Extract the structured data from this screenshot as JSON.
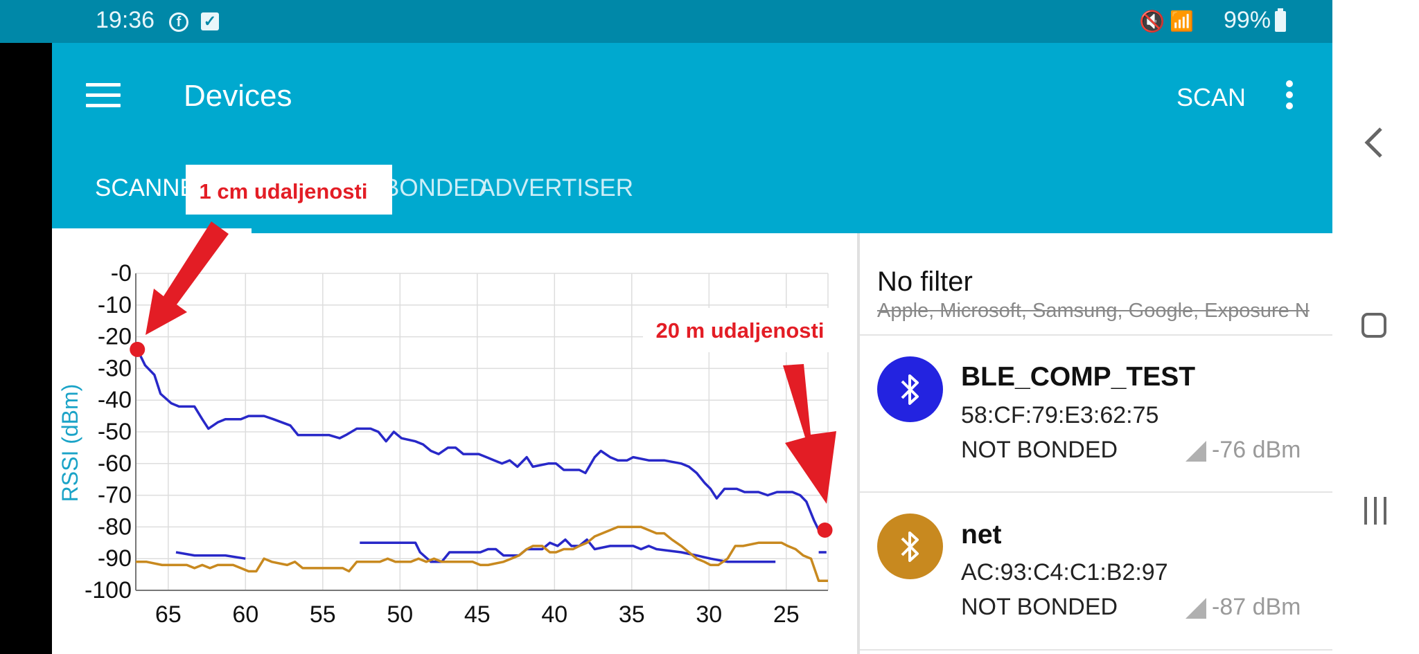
{
  "status_bar": {
    "time": "19:36",
    "battery": "99%"
  },
  "toolbar": {
    "title": "Devices",
    "scan_label": "SCAN"
  },
  "tabs": {
    "scanner": "SCANNER",
    "bonded": "BONDED",
    "advertiser": "ADVERTISER"
  },
  "annotations": {
    "near": "1 cm udaljenosti",
    "far": "20 m udaljenosti"
  },
  "filter": {
    "title": "No filter",
    "subtitle": "Apple, Microsoft, Samsung, Google, Exposure N"
  },
  "devices": [
    {
      "name": "BLE_COMP_TEST",
      "mac": "58:CF:79:E3:62:75",
      "bond": "NOT BONDED",
      "rssi": "-76 dBm",
      "color": "#2323e0"
    },
    {
      "name": "net",
      "mac": "AC:93:C4:C1:B2:97",
      "bond": "NOT BONDED",
      "rssi": "-87 dBm",
      "color": "#c8891f"
    }
  ],
  "colors": {
    "status_bar": "#0088a8",
    "app_bar": "#00a9cf",
    "annotation": "#e31d25",
    "axis_label": "#1aa3c7"
  },
  "chart_data": {
    "type": "line",
    "ylabel": "RSSI (dBm)",
    "xlabel": "",
    "xlim": [
      67.1,
      22.3
    ],
    "ylim": [
      -100,
      0
    ],
    "y_ticks": [
      "-0",
      "-10",
      "-20",
      "-30",
      "-40",
      "-50",
      "-60",
      "-70",
      "-80",
      "-90",
      "-100"
    ],
    "x_ticks": [
      65,
      60,
      55,
      50,
      45,
      40,
      35,
      30,
      25
    ],
    "grid": true,
    "series": [
      {
        "color": "#2828c8",
        "segments": [
          [
            [
              67.0,
              -24
            ],
            [
              66.5,
              -29
            ],
            [
              65.9,
              -32
            ],
            [
              65.5,
              -38
            ],
            [
              64.8,
              -41
            ],
            [
              64.3,
              -42
            ],
            [
              63.3,
              -42
            ],
            [
              62.8,
              -46
            ],
            [
              62.4,
              -49
            ],
            [
              61.8,
              -47
            ],
            [
              61.3,
              -46
            ],
            [
              60.3,
              -46
            ],
            [
              59.8,
              -45
            ],
            [
              58.8,
              -45
            ],
            [
              58.2,
              -46
            ],
            [
              57.1,
              -48
            ],
            [
              56.6,
              -51
            ],
            [
              55.6,
              -51
            ],
            [
              54.6,
              -51
            ],
            [
              53.9,
              -52
            ],
            [
              53.5,
              -51
            ],
            [
              52.8,
              -49
            ],
            [
              51.9,
              -49
            ],
            [
              51.4,
              -50
            ],
            [
              50.9,
              -53
            ],
            [
              50.4,
              -50
            ],
            [
              49.9,
              -52
            ],
            [
              49.0,
              -53
            ],
            [
              48.5,
              -54
            ],
            [
              48.0,
              -56
            ],
            [
              47.5,
              -57
            ],
            [
              46.9,
              -55
            ],
            [
              46.4,
              -55
            ],
            [
              45.9,
              -57
            ],
            [
              44.9,
              -57
            ],
            [
              44.4,
              -58
            ],
            [
              43.9,
              -59
            ],
            [
              43.4,
              -60
            ],
            [
              42.9,
              -59
            ],
            [
              42.4,
              -61
            ],
            [
              41.8,
              -58
            ],
            [
              41.4,
              -61
            ],
            [
              40.4,
              -60
            ],
            [
              39.9,
              -60
            ],
            [
              39.4,
              -62
            ],
            [
              38.4,
              -62
            ],
            [
              38.0,
              -63
            ],
            [
              37.4,
              -58
            ],
            [
              37.0,
              -56
            ],
            [
              36.4,
              -58
            ],
            [
              35.9,
              -59
            ],
            [
              35.3,
              -59
            ],
            [
              34.9,
              -58
            ],
            [
              33.9,
              -59
            ],
            [
              33.4,
              -59
            ],
            [
              32.9,
              -59
            ],
            [
              31.8,
              -60
            ],
            [
              31.3,
              -61
            ],
            [
              30.8,
              -63
            ],
            [
              30.3,
              -66
            ],
            [
              29.9,
              -68
            ],
            [
              29.5,
              -71
            ],
            [
              29.0,
              -68
            ],
            [
              28.2,
              -68
            ],
            [
              27.7,
              -69
            ],
            [
              27.2,
              -69
            ],
            [
              26.8,
              -69
            ],
            [
              26.2,
              -70
            ],
            [
              25.6,
              -69
            ],
            [
              24.6,
              -69
            ],
            [
              24.1,
              -70
            ],
            [
              23.7,
              -72
            ],
            [
              23.2,
              -78
            ],
            [
              22.8,
              -82
            ]
          ]
        ]
      },
      {
        "color": "#2828c8",
        "segments": [
          [
            [
              64.5,
              -88
            ],
            [
              63.3,
              -89
            ],
            [
              61.3,
              -89
            ],
            [
              60.0,
              -90
            ]
          ],
          [
            [
              52.6,
              -85
            ],
            [
              51.5,
              -85
            ],
            [
              49.0,
              -85
            ],
            [
              48.7,
              -88
            ],
            [
              48.0,
              -91
            ],
            [
              47.3,
              -91
            ],
            [
              46.8,
              -88
            ],
            [
              46.3,
              -88
            ],
            [
              44.8,
              -88
            ],
            [
              44.3,
              -87
            ],
            [
              43.8,
              -87
            ],
            [
              43.3,
              -89
            ],
            [
              42.3,
              -89
            ],
            [
              41.8,
              -87
            ],
            [
              40.8,
              -87
            ],
            [
              40.3,
              -85
            ],
            [
              39.8,
              -86
            ],
            [
              39.3,
              -84
            ],
            [
              38.9,
              -86
            ],
            [
              38.4,
              -86
            ],
            [
              37.9,
              -84
            ],
            [
              37.4,
              -87
            ],
            [
              36.4,
              -86
            ],
            [
              34.9,
              -86
            ],
            [
              34.4,
              -87
            ],
            [
              33.9,
              -86
            ],
            [
              33.4,
              -87
            ],
            [
              31.8,
              -88
            ],
            [
              30.8,
              -89
            ],
            [
              29.9,
              -90
            ],
            [
              28.8,
              -91
            ],
            [
              25.7,
              -91
            ]
          ],
          [
            [
              22.9,
              -88
            ],
            [
              22.4,
              -88
            ]
          ]
        ]
      },
      {
        "color": "#c8891f",
        "segments": [
          [
            [
              67.1,
              -91
            ],
            [
              66.4,
              -91
            ],
            [
              65.4,
              -92
            ],
            [
              64.9,
              -92
            ],
            [
              63.8,
              -92
            ],
            [
              63.3,
              -93
            ],
            [
              62.8,
              -92
            ],
            [
              62.3,
              -93
            ],
            [
              61.8,
              -92
            ],
            [
              61.3,
              -92
            ],
            [
              60.8,
              -92
            ],
            [
              60.3,
              -93
            ],
            [
              59.8,
              -94
            ],
            [
              59.3,
              -94
            ],
            [
              58.8,
              -90
            ],
            [
              58.3,
              -91
            ],
            [
              57.3,
              -92
            ],
            [
              56.8,
              -91
            ],
            [
              56.3,
              -93
            ],
            [
              54.7,
              -93
            ],
            [
              53.7,
              -93
            ],
            [
              53.3,
              -94
            ],
            [
              52.8,
              -91
            ],
            [
              51.3,
              -91
            ],
            [
              50.8,
              -90
            ],
            [
              50.3,
              -91
            ],
            [
              49.3,
              -91
            ],
            [
              48.8,
              -90
            ],
            [
              48.3,
              -91
            ],
            [
              47.8,
              -90
            ],
            [
              47.3,
              -91
            ],
            [
              45.8,
              -91
            ],
            [
              45.3,
              -91
            ],
            [
              44.8,
              -92
            ],
            [
              44.3,
              -92
            ],
            [
              43.3,
              -91
            ],
            [
              42.8,
              -90
            ],
            [
              42.3,
              -89
            ],
            [
              41.8,
              -87
            ],
            [
              41.4,
              -86
            ],
            [
              40.8,
              -86
            ],
            [
              40.3,
              -88
            ],
            [
              39.9,
              -88
            ],
            [
              39.4,
              -87
            ],
            [
              38.8,
              -87
            ],
            [
              38.4,
              -86
            ],
            [
              37.9,
              -85
            ],
            [
              37.4,
              -83
            ],
            [
              36.4,
              -81
            ],
            [
              35.9,
              -80
            ],
            [
              35.4,
              -80
            ],
            [
              34.4,
              -80
            ],
            [
              33.9,
              -81
            ],
            [
              33.4,
              -82
            ],
            [
              32.9,
              -82
            ],
            [
              32.4,
              -84
            ],
            [
              31.8,
              -86
            ],
            [
              31.3,
              -88
            ],
            [
              30.8,
              -90
            ],
            [
              30.3,
              -91
            ],
            [
              29.9,
              -92
            ],
            [
              29.4,
              -92
            ],
            [
              28.8,
              -90
            ],
            [
              28.3,
              -86
            ],
            [
              27.8,
              -86
            ],
            [
              26.8,
              -85
            ],
            [
              26.3,
              -85
            ],
            [
              25.3,
              -85
            ],
            [
              24.9,
              -86
            ],
            [
              24.4,
              -87
            ],
            [
              23.9,
              -89
            ],
            [
              23.4,
              -90
            ],
            [
              22.9,
              -97
            ],
            [
              22.3,
              -97
            ]
          ]
        ]
      }
    ],
    "highlight_points": [
      [
        67.0,
        -24
      ],
      [
        22.5,
        -81
      ]
    ]
  }
}
